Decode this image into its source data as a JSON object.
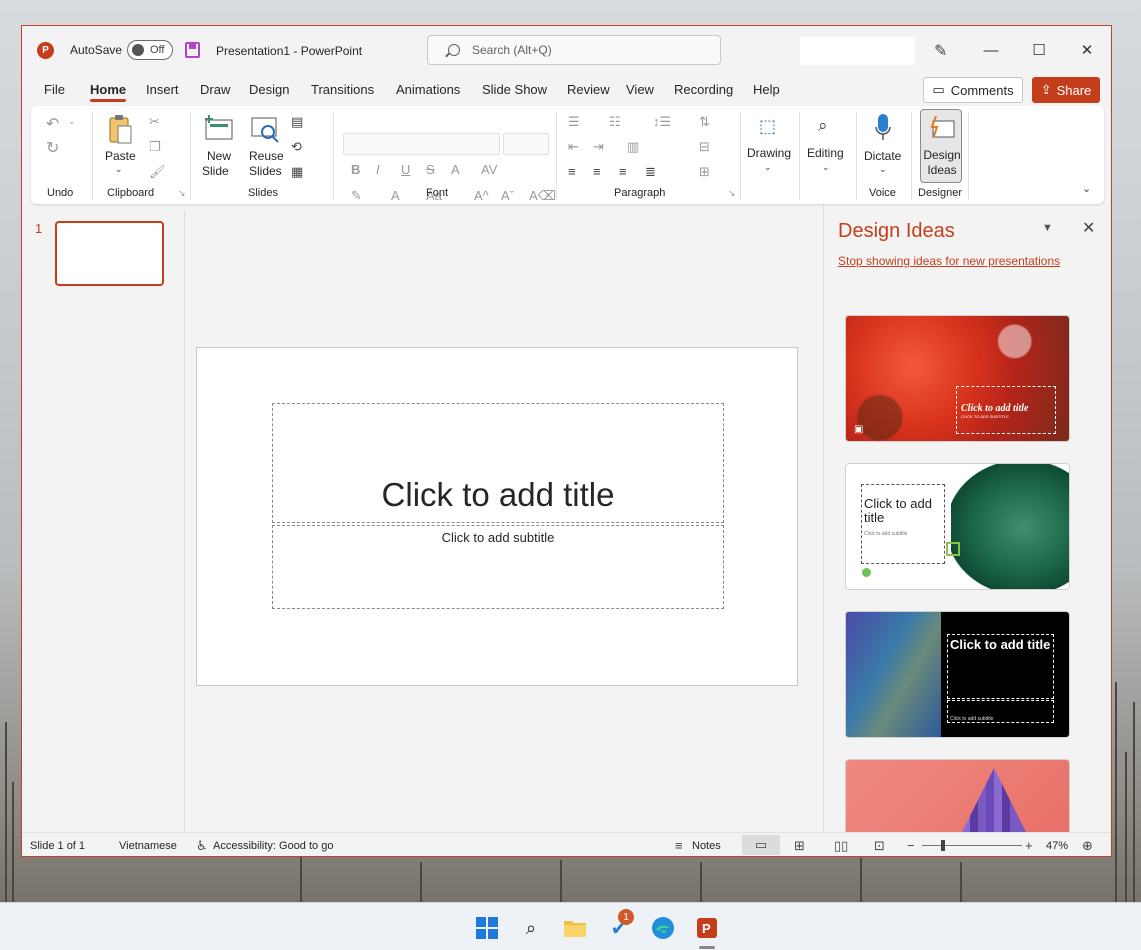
{
  "window": {
    "app_logo": "P",
    "autosave_label": "AutoSave",
    "autosave_state": "Off",
    "doc_title": "Presentation1  -  PowerPoint",
    "search_placeholder": "Search (Alt+Q)",
    "icons": [
      "save-icon",
      "search-icon",
      "pen-icon",
      "minimize-icon",
      "maximize-icon",
      "close-icon"
    ]
  },
  "tabs": [
    "File",
    "Home",
    "Insert",
    "Draw",
    "Design",
    "Transitions",
    "Animations",
    "Slide Show",
    "Review",
    "View",
    "Recording",
    "Help"
  ],
  "active_tab": "Home",
  "header_buttons": {
    "comments": "Comments",
    "share": "Share"
  },
  "ribbon": {
    "groups": {
      "undo": "Undo",
      "clipboard": "Clipboard",
      "slides": "Slides",
      "font": "Font",
      "paragraph": "Paragraph",
      "voice": "Voice",
      "designer": "Designer"
    },
    "buttons": {
      "paste": "Paste",
      "new_slide_1": "New",
      "new_slide_2": "Slide",
      "reuse_1": "Reuse",
      "reuse_2": "Slides",
      "drawing": "Drawing",
      "editing": "Editing",
      "dictate": "Dictate",
      "design_ideas_1": "Design",
      "design_ideas_2": "Ideas"
    },
    "font_glyphs": {
      "bold": "B",
      "italic": "I",
      "underline": "U",
      "strike": "S",
      "shadow": "A",
      "grow": "A",
      "shrink": "A",
      "clear": "A"
    }
  },
  "slides_pane": {
    "slide_number": "1"
  },
  "slide": {
    "title_placeholder": "Click to add title",
    "subtitle_placeholder": "Click to add subtitle"
  },
  "design_pane": {
    "title": "Design Ideas",
    "link": "Stop showing ideas for new presentations",
    "cards": [
      {
        "title": "Click to add title",
        "subtitle": "CLICK TO ADD SUBTITLE"
      },
      {
        "title": "Click to add title",
        "subtitle": "Click to add subtitle"
      },
      {
        "title": "Click to add title",
        "subtitle": "Click to add subtitle"
      },
      {
        "title": "",
        "subtitle": ""
      }
    ]
  },
  "statusbar": {
    "slide_info": "Slide 1 of 1",
    "language": "Vietnamese",
    "accessibility": "Accessibility: Good to go",
    "notes": "Notes",
    "zoom": "47%"
  },
  "taskbar": {
    "badge_count": "1",
    "icons": [
      "windows-start-icon",
      "search-icon",
      "file-explorer-icon",
      "todo-icon",
      "edge-icon",
      "powerpoint-icon"
    ]
  },
  "colors": {
    "accent": "#c43e1c",
    "ribbon_bg": "#ffffff",
    "window_bg": "#f3f3f3"
  }
}
